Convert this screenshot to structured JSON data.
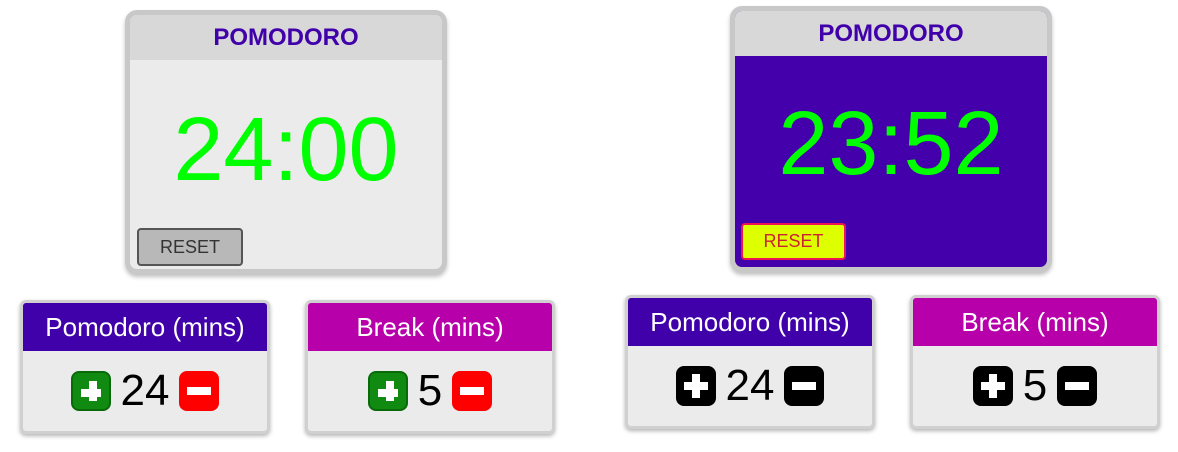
{
  "left": {
    "timer": {
      "title": "POMODORO",
      "time": "24:00",
      "reset_label": "RESET"
    },
    "session": {
      "label": "Pomodoro (mins)",
      "value": "24"
    },
    "break": {
      "label": "Break (mins)",
      "value": "5"
    }
  },
  "right": {
    "timer": {
      "title": "POMODORO",
      "time": "23:52",
      "reset_label": "RESET"
    },
    "session": {
      "label": "Pomodoro (mins)",
      "value": "24"
    },
    "break": {
      "label": "Break (mins)",
      "value": "5"
    }
  },
  "colors": {
    "purple": "#4000aa",
    "magenta": "#b800aa",
    "green": "#00ff00",
    "plus_green": "#118a11",
    "minus_red": "#ff0000",
    "yellow": "#ddff00"
  },
  "icons": {
    "increment": "plus-icon",
    "decrement": "minus-icon"
  }
}
